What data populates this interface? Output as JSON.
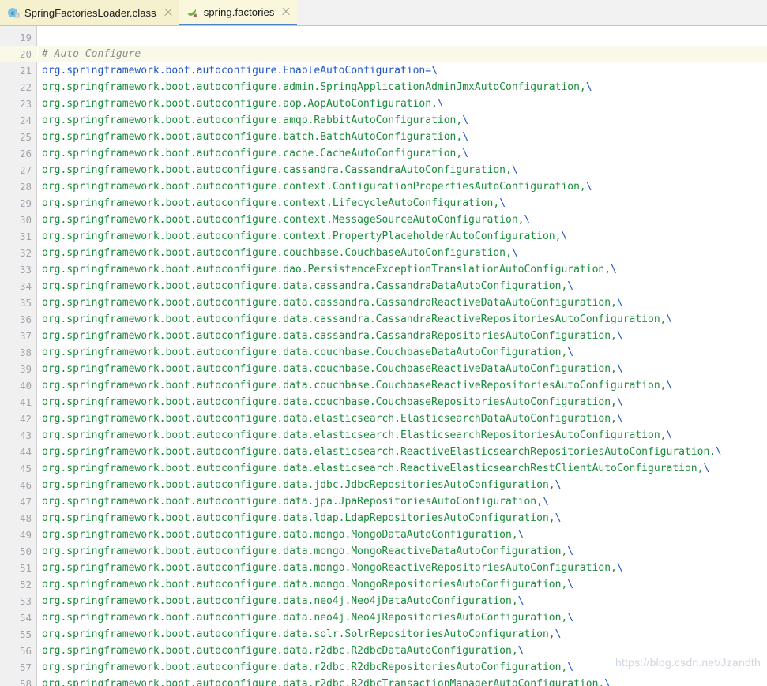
{
  "tabs": [
    {
      "label": "SpringFactoriesLoader.class",
      "icon": "java-class-icon",
      "active": false,
      "close_icon": "close-icon"
    },
    {
      "label": "spring.factories",
      "icon": "spring-leaf-icon",
      "active": true,
      "close_icon": "close-icon"
    }
  ],
  "editor": {
    "first_line_number": 19,
    "line_height": 21,
    "highlighted_line": 20,
    "colors": {
      "comment": "#8c8c8c",
      "key": "#2054c4",
      "value": "#1a8c3c",
      "continuation": "#2054c4",
      "gutter_bg": "#f0f0f0",
      "gutter_text": "#a0a4ad",
      "highlight_row": "#faf8e6",
      "background": "#ffffff"
    },
    "lines": [
      {
        "n": 19,
        "tokens": []
      },
      {
        "n": 20,
        "tokens": [
          {
            "t": "# Auto Configure",
            "c": "comment"
          }
        ]
      },
      {
        "n": 21,
        "tokens": [
          {
            "t": "org.springframework.boot.autoconfigure.EnableAutoConfiguration=\\",
            "c": "key"
          }
        ]
      },
      {
        "n": 22,
        "tokens": [
          {
            "t": "org.springframework.boot.autoconfigure.admin.SpringApplicationAdminJmxAutoConfiguration,",
            "c": "value"
          },
          {
            "t": "\\",
            "c": "cont"
          }
        ]
      },
      {
        "n": 23,
        "tokens": [
          {
            "t": "org.springframework.boot.autoconfigure.aop.AopAutoConfiguration,",
            "c": "value"
          },
          {
            "t": "\\",
            "c": "cont"
          }
        ]
      },
      {
        "n": 24,
        "tokens": [
          {
            "t": "org.springframework.boot.autoconfigure.amqp.RabbitAutoConfiguration,",
            "c": "value"
          },
          {
            "t": "\\",
            "c": "cont"
          }
        ]
      },
      {
        "n": 25,
        "tokens": [
          {
            "t": "org.springframework.boot.autoconfigure.batch.BatchAutoConfiguration,",
            "c": "value"
          },
          {
            "t": "\\",
            "c": "cont"
          }
        ]
      },
      {
        "n": 26,
        "tokens": [
          {
            "t": "org.springframework.boot.autoconfigure.cache.CacheAutoConfiguration,",
            "c": "value"
          },
          {
            "t": "\\",
            "c": "cont"
          }
        ]
      },
      {
        "n": 27,
        "tokens": [
          {
            "t": "org.springframework.boot.autoconfigure.cassandra.CassandraAutoConfiguration,",
            "c": "value"
          },
          {
            "t": "\\",
            "c": "cont"
          }
        ]
      },
      {
        "n": 28,
        "tokens": [
          {
            "t": "org.springframework.boot.autoconfigure.context.ConfigurationPropertiesAutoConfiguration,",
            "c": "value"
          },
          {
            "t": "\\",
            "c": "cont"
          }
        ]
      },
      {
        "n": 29,
        "tokens": [
          {
            "t": "org.springframework.boot.autoconfigure.context.LifecycleAutoConfiguration,",
            "c": "value"
          },
          {
            "t": "\\",
            "c": "cont"
          }
        ]
      },
      {
        "n": 30,
        "tokens": [
          {
            "t": "org.springframework.boot.autoconfigure.context.MessageSourceAutoConfiguration,",
            "c": "value"
          },
          {
            "t": "\\",
            "c": "cont"
          }
        ]
      },
      {
        "n": 31,
        "tokens": [
          {
            "t": "org.springframework.boot.autoconfigure.context.PropertyPlaceholderAutoConfiguration,",
            "c": "value"
          },
          {
            "t": "\\",
            "c": "cont"
          }
        ]
      },
      {
        "n": 32,
        "tokens": [
          {
            "t": "org.springframework.boot.autoconfigure.couchbase.CouchbaseAutoConfiguration,",
            "c": "value"
          },
          {
            "t": "\\",
            "c": "cont"
          }
        ]
      },
      {
        "n": 33,
        "tokens": [
          {
            "t": "org.springframework.boot.autoconfigure.dao.PersistenceExceptionTranslationAutoConfiguration,",
            "c": "value"
          },
          {
            "t": "\\",
            "c": "cont"
          }
        ]
      },
      {
        "n": 34,
        "tokens": [
          {
            "t": "org.springframework.boot.autoconfigure.data.cassandra.CassandraDataAutoConfiguration,",
            "c": "value"
          },
          {
            "t": "\\",
            "c": "cont"
          }
        ]
      },
      {
        "n": 35,
        "tokens": [
          {
            "t": "org.springframework.boot.autoconfigure.data.cassandra.CassandraReactiveDataAutoConfiguration,",
            "c": "value"
          },
          {
            "t": "\\",
            "c": "cont"
          }
        ]
      },
      {
        "n": 36,
        "tokens": [
          {
            "t": "org.springframework.boot.autoconfigure.data.cassandra.CassandraReactiveRepositoriesAutoConfiguration,",
            "c": "value"
          },
          {
            "t": "\\",
            "c": "cont"
          }
        ]
      },
      {
        "n": 37,
        "tokens": [
          {
            "t": "org.springframework.boot.autoconfigure.data.cassandra.CassandraRepositoriesAutoConfiguration,",
            "c": "value"
          },
          {
            "t": "\\",
            "c": "cont"
          }
        ]
      },
      {
        "n": 38,
        "tokens": [
          {
            "t": "org.springframework.boot.autoconfigure.data.couchbase.CouchbaseDataAutoConfiguration,",
            "c": "value"
          },
          {
            "t": "\\",
            "c": "cont"
          }
        ]
      },
      {
        "n": 39,
        "tokens": [
          {
            "t": "org.springframework.boot.autoconfigure.data.couchbase.CouchbaseReactiveDataAutoConfiguration,",
            "c": "value"
          },
          {
            "t": "\\",
            "c": "cont"
          }
        ]
      },
      {
        "n": 40,
        "tokens": [
          {
            "t": "org.springframework.boot.autoconfigure.data.couchbase.CouchbaseReactiveRepositoriesAutoConfiguration,",
            "c": "value"
          },
          {
            "t": "\\",
            "c": "cont"
          }
        ]
      },
      {
        "n": 41,
        "tokens": [
          {
            "t": "org.springframework.boot.autoconfigure.data.couchbase.CouchbaseRepositoriesAutoConfiguration,",
            "c": "value"
          },
          {
            "t": "\\",
            "c": "cont"
          }
        ]
      },
      {
        "n": 42,
        "tokens": [
          {
            "t": "org.springframework.boot.autoconfigure.data.elasticsearch.ElasticsearchDataAutoConfiguration,",
            "c": "value"
          },
          {
            "t": "\\",
            "c": "cont"
          }
        ]
      },
      {
        "n": 43,
        "tokens": [
          {
            "t": "org.springframework.boot.autoconfigure.data.elasticsearch.ElasticsearchRepositoriesAutoConfiguration,",
            "c": "value"
          },
          {
            "t": "\\",
            "c": "cont"
          }
        ]
      },
      {
        "n": 44,
        "tokens": [
          {
            "t": "org.springframework.boot.autoconfigure.data.elasticsearch.ReactiveElasticsearchRepositoriesAutoConfiguration,",
            "c": "value"
          },
          {
            "t": "\\",
            "c": "cont"
          }
        ]
      },
      {
        "n": 45,
        "tokens": [
          {
            "t": "org.springframework.boot.autoconfigure.data.elasticsearch.ReactiveElasticsearchRestClientAutoConfiguration,",
            "c": "value"
          },
          {
            "t": "\\",
            "c": "cont"
          }
        ]
      },
      {
        "n": 46,
        "tokens": [
          {
            "t": "org.springframework.boot.autoconfigure.data.jdbc.JdbcRepositoriesAutoConfiguration,",
            "c": "value"
          },
          {
            "t": "\\",
            "c": "cont"
          }
        ]
      },
      {
        "n": 47,
        "tokens": [
          {
            "t": "org.springframework.boot.autoconfigure.data.jpa.JpaRepositoriesAutoConfiguration,",
            "c": "value"
          },
          {
            "t": "\\",
            "c": "cont"
          }
        ]
      },
      {
        "n": 48,
        "tokens": [
          {
            "t": "org.springframework.boot.autoconfigure.data.ldap.LdapRepositoriesAutoConfiguration,",
            "c": "value"
          },
          {
            "t": "\\",
            "c": "cont"
          }
        ]
      },
      {
        "n": 49,
        "tokens": [
          {
            "t": "org.springframework.boot.autoconfigure.data.mongo.MongoDataAutoConfiguration,",
            "c": "value"
          },
          {
            "t": "\\",
            "c": "cont"
          }
        ]
      },
      {
        "n": 50,
        "tokens": [
          {
            "t": "org.springframework.boot.autoconfigure.data.mongo.MongoReactiveDataAutoConfiguration,",
            "c": "value"
          },
          {
            "t": "\\",
            "c": "cont"
          }
        ]
      },
      {
        "n": 51,
        "tokens": [
          {
            "t": "org.springframework.boot.autoconfigure.data.mongo.MongoReactiveRepositoriesAutoConfiguration,",
            "c": "value"
          },
          {
            "t": "\\",
            "c": "cont"
          }
        ]
      },
      {
        "n": 52,
        "tokens": [
          {
            "t": "org.springframework.boot.autoconfigure.data.mongo.MongoRepositoriesAutoConfiguration,",
            "c": "value"
          },
          {
            "t": "\\",
            "c": "cont"
          }
        ]
      },
      {
        "n": 53,
        "tokens": [
          {
            "t": "org.springframework.boot.autoconfigure.data.neo4j.Neo4jDataAutoConfiguration,",
            "c": "value"
          },
          {
            "t": "\\",
            "c": "cont"
          }
        ]
      },
      {
        "n": 54,
        "tokens": [
          {
            "t": "org.springframework.boot.autoconfigure.data.neo4j.Neo4jRepositoriesAutoConfiguration,",
            "c": "value"
          },
          {
            "t": "\\",
            "c": "cont"
          }
        ]
      },
      {
        "n": 55,
        "tokens": [
          {
            "t": "org.springframework.boot.autoconfigure.data.solr.SolrRepositoriesAutoConfiguration,",
            "c": "value"
          },
          {
            "t": "\\",
            "c": "cont"
          }
        ]
      },
      {
        "n": 56,
        "tokens": [
          {
            "t": "org.springframework.boot.autoconfigure.data.r2dbc.R2dbcDataAutoConfiguration,",
            "c": "value"
          },
          {
            "t": "\\",
            "c": "cont"
          }
        ]
      },
      {
        "n": 57,
        "tokens": [
          {
            "t": "org.springframework.boot.autoconfigure.data.r2dbc.R2dbcRepositoriesAutoConfiguration,",
            "c": "value"
          },
          {
            "t": "\\",
            "c": "cont"
          }
        ]
      },
      {
        "n": 58,
        "tokens": [
          {
            "t": "org.springframework.boot.autoconfigure.data.r2dbc.R2dbcTransactionManagerAutoConfiguration,",
            "c": "value"
          },
          {
            "t": "\\",
            "c": "cont"
          }
        ]
      }
    ]
  },
  "watermark": {
    "text": "https://blog.csdn.net/Jzandth"
  }
}
